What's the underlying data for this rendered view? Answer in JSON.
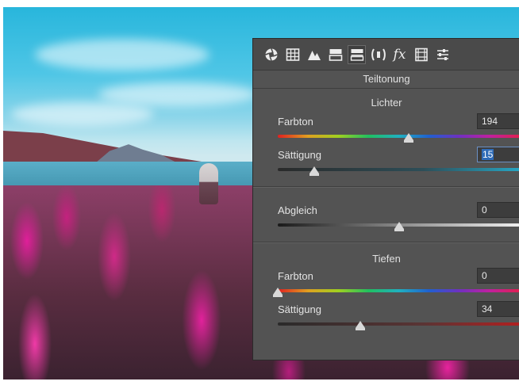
{
  "panel": {
    "title": "Teiltonung",
    "tabs": [
      {
        "icon": "aperture-icon"
      },
      {
        "icon": "grid-icon"
      },
      {
        "icon": "mountain-icon"
      },
      {
        "icon": "levels-icon"
      },
      {
        "icon": "split-toning-icon",
        "active": true
      },
      {
        "icon": "lens-icon"
      },
      {
        "icon": "fx-icon"
      },
      {
        "icon": "camera-calibration-icon"
      },
      {
        "icon": "presets-icon"
      }
    ],
    "fx_glyph": "fx"
  },
  "highlights": {
    "heading": "Lichter",
    "hue": {
      "label": "Farbton",
      "value": "194",
      "fraction": 0.54
    },
    "saturation": {
      "label": "Sättigung",
      "value": "15",
      "fraction": 0.15
    }
  },
  "balance": {
    "label": "Abgleich",
    "value": "0",
    "fraction": 0.5
  },
  "shadows": {
    "heading": "Tiefen",
    "hue": {
      "label": "Farbton",
      "value": "0",
      "fraction": 0.0
    },
    "saturation": {
      "label": "Sättigung",
      "value": "34",
      "fraction": 0.34
    }
  },
  "colors": {
    "panel_bg": "#535353",
    "selection": "#2f6cb8"
  }
}
